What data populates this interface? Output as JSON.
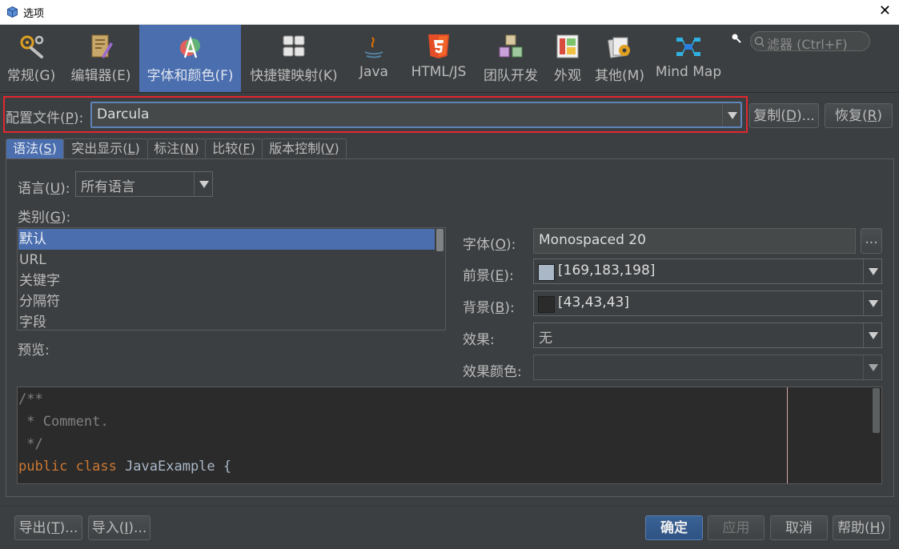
{
  "window": {
    "title": "选项",
    "close_glyph": "✕"
  },
  "toolbar": {
    "items": [
      {
        "label": "常规(G)",
        "icon": "wrench-gear-icon"
      },
      {
        "label": "编辑器(E)",
        "icon": "editor-icon"
      },
      {
        "label": "字体和颜色(F)",
        "icon": "font-color-icon",
        "active": true
      },
      {
        "label": "快捷键映射(K)",
        "icon": "keyboard-icon"
      },
      {
        "label": "Java",
        "icon": "java-icon"
      },
      {
        "label": "HTML/JS",
        "icon": "html5-icon"
      },
      {
        "label": "团队开发",
        "icon": "team-icon"
      },
      {
        "label": "外观",
        "icon": "appearance-icon"
      },
      {
        "label": "其他(M)",
        "icon": "misc-icon"
      },
      {
        "label": "Mind Map",
        "icon": "mindmap-icon"
      }
    ],
    "search_placeholder": "滤器 (Ctrl+F)",
    "search_prefix": "Q"
  },
  "profile": {
    "label": "配置文件(",
    "mnemonic": "P",
    "label_end": "):",
    "value": "Darcula",
    "copy_label": "复制(",
    "copy_mn": "D",
    "copy_end": ")...",
    "restore_label": "恢复(",
    "restore_mn": "R",
    "restore_end": ")"
  },
  "tabs": [
    {
      "a": "语法(",
      "mn": "S",
      "b": ")",
      "active": true
    },
    {
      "a": "突出显示(",
      "mn": "L",
      "b": ")"
    },
    {
      "a": "标注(",
      "mn": "N",
      "b": ")"
    },
    {
      "a": "比较(",
      "mn": "F",
      "b": ")"
    },
    {
      "a": "版本控制(",
      "mn": "V",
      "b": ")"
    }
  ],
  "syntax": {
    "language_label": "语言(",
    "language_mn": "U",
    "language_end": "):",
    "language_value": "所有语言",
    "category_label": "类别(",
    "category_mn": "G",
    "category_end": "):",
    "categories": [
      "默认",
      "URL",
      "关键字",
      "分隔符",
      "字段"
    ],
    "preview_label": "预览:",
    "font_label": "字体(",
    "font_mn": "O",
    "font_end": "):",
    "font_value": "Monospaced 20",
    "font_browse": "...",
    "fg_label": "前景(",
    "fg_mn": "E",
    "fg_end": "):",
    "fg_value": "[169,183,198]",
    "fg_color": "#a9b7c6",
    "bg_label": "背景(",
    "bg_mn": "B",
    "bg_end": "):",
    "bg_value": "[43,43,43]",
    "bg_color": "#2b2b2b",
    "effects_label": "效果:",
    "effects_value": "无",
    "effect_color_label": "效果颜色:",
    "effect_color_value": ""
  },
  "preview": {
    "lines": [
      [
        {
          "t": "/**",
          "c": "c-com"
        }
      ],
      [
        {
          "t": " * Comment.",
          "c": "c-com"
        }
      ],
      [
        {
          "t": " */",
          "c": "c-com"
        }
      ],
      [
        {
          "t": "public class ",
          "c": "c-kw"
        },
        {
          "t": "JavaExample {",
          "c": "c-txt"
        }
      ]
    ]
  },
  "footer": {
    "export_a": "导出(",
    "export_mn": "T",
    "export_b": ")...",
    "import_a": "导入(",
    "import_mn": "I",
    "import_b": ")...",
    "ok": "确定",
    "apply": "应用",
    "cancel": "取消",
    "help_a": "帮助(",
    "help_mn": "H",
    "help_b": ")"
  }
}
